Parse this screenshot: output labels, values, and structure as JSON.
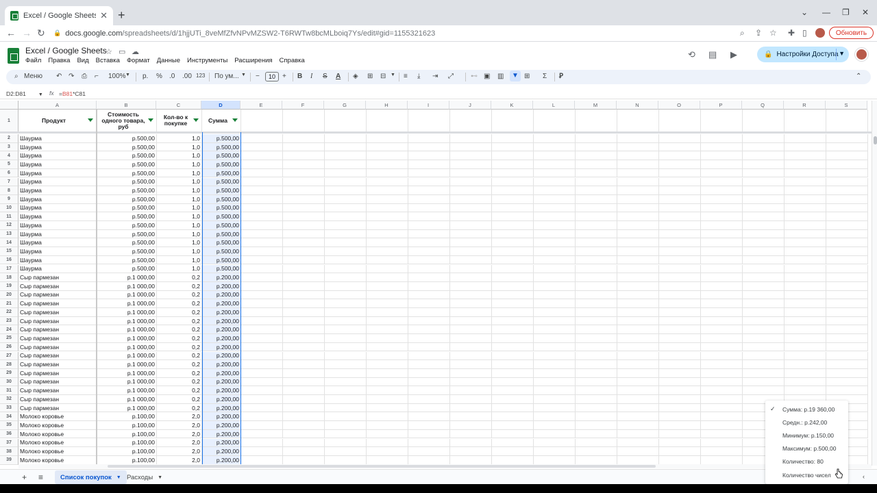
{
  "browser": {
    "tab_title": "Excel / Google Sheets - Google T",
    "url_host": "docs.google.com",
    "url_path": "/spreadsheets/d/1hjjUTi_8veMfZfvNPvMZSW2-T6RWTw8bcMLboiq7Ys/edit#gid=1155321623",
    "update_label": "Обновить"
  },
  "doc": {
    "title": "Excel / Google Sheets",
    "menus": [
      "Файл",
      "Правка",
      "Вид",
      "Вставка",
      "Формат",
      "Данные",
      "Инструменты",
      "Расширения",
      "Справка"
    ],
    "share_label": "Настройки Доступа"
  },
  "toolbar": {
    "search_label": "Меню",
    "zoom": "100%",
    "currency": "р.",
    "percent": "%",
    "dec_less": ".0",
    "dec_more": ".00",
    "num_format": "123",
    "font": "По ум...",
    "font_size": "10"
  },
  "formula_bar": {
    "name_box": "D2:D81",
    "formula_prefix": "=",
    "formula_ref1": "B81",
    "formula_rest": "*C81"
  },
  "grid": {
    "columns": [
      "A",
      "B",
      "C",
      "D",
      "E",
      "F",
      "G",
      "H",
      "I",
      "J",
      "K",
      "L",
      "M",
      "N",
      "O",
      "P",
      "Q",
      "R",
      "S"
    ],
    "headers": {
      "a": "Продукт",
      "b": [
        "Стоимость",
        "одного товара,",
        "руб"
      ],
      "c": [
        "Кол-во к",
        "покупке"
      ],
      "d": "Сумма"
    },
    "rows": [
      {
        "n": "2",
        "a": "Шаурма",
        "b": "р.500,00",
        "c": "1,0",
        "d": "р.500,00"
      },
      {
        "n": "3",
        "a": "Шаурма",
        "b": "р.500,00",
        "c": "1,0",
        "d": "р.500,00"
      },
      {
        "n": "4",
        "a": "Шаурма",
        "b": "р.500,00",
        "c": "1,0",
        "d": "р.500,00"
      },
      {
        "n": "5",
        "a": "Шаурма",
        "b": "р.500,00",
        "c": "1,0",
        "d": "р.500,00"
      },
      {
        "n": "6",
        "a": "Шаурма",
        "b": "р.500,00",
        "c": "1,0",
        "d": "р.500,00"
      },
      {
        "n": "7",
        "a": "Шаурма",
        "b": "р.500,00",
        "c": "1,0",
        "d": "р.500,00"
      },
      {
        "n": "8",
        "a": "Шаурма",
        "b": "р.500,00",
        "c": "1,0",
        "d": "р.500,00"
      },
      {
        "n": "9",
        "a": "Шаурма",
        "b": "р.500,00",
        "c": "1,0",
        "d": "р.500,00"
      },
      {
        "n": "10",
        "a": "Шаурма",
        "b": "р.500,00",
        "c": "1,0",
        "d": "р.500,00"
      },
      {
        "n": "11",
        "a": "Шаурма",
        "b": "р.500,00",
        "c": "1,0",
        "d": "р.500,00"
      },
      {
        "n": "12",
        "a": "Шаурма",
        "b": "р.500,00",
        "c": "1,0",
        "d": "р.500,00"
      },
      {
        "n": "13",
        "a": "Шаурма",
        "b": "р.500,00",
        "c": "1,0",
        "d": "р.500,00"
      },
      {
        "n": "14",
        "a": "Шаурма",
        "b": "р.500,00",
        "c": "1,0",
        "d": "р.500,00"
      },
      {
        "n": "15",
        "a": "Шаурма",
        "b": "р.500,00",
        "c": "1,0",
        "d": "р.500,00"
      },
      {
        "n": "16",
        "a": "Шаурма",
        "b": "р.500,00",
        "c": "1,0",
        "d": "р.500,00"
      },
      {
        "n": "17",
        "a": "Шаурма",
        "b": "р.500,00",
        "c": "1,0",
        "d": "р.500,00"
      },
      {
        "n": "18",
        "a": "Сыр пармезан",
        "b": "р.1 000,00",
        "c": "0,2",
        "d": "р.200,00"
      },
      {
        "n": "19",
        "a": "Сыр пармезан",
        "b": "р.1 000,00",
        "c": "0,2",
        "d": "р.200,00"
      },
      {
        "n": "20",
        "a": "Сыр пармезан",
        "b": "р.1 000,00",
        "c": "0,2",
        "d": "р.200,00"
      },
      {
        "n": "21",
        "a": "Сыр пармезан",
        "b": "р.1 000,00",
        "c": "0,2",
        "d": "р.200,00"
      },
      {
        "n": "22",
        "a": "Сыр пармезан",
        "b": "р.1 000,00",
        "c": "0,2",
        "d": "р.200,00"
      },
      {
        "n": "23",
        "a": "Сыр пармезан",
        "b": "р.1 000,00",
        "c": "0,2",
        "d": "р.200,00"
      },
      {
        "n": "24",
        "a": "Сыр пармезан",
        "b": "р.1 000,00",
        "c": "0,2",
        "d": "р.200,00"
      },
      {
        "n": "25",
        "a": "Сыр пармезан",
        "b": "р.1 000,00",
        "c": "0,2",
        "d": "р.200,00"
      },
      {
        "n": "26",
        "a": "Сыр пармезан",
        "b": "р.1 000,00",
        "c": "0,2",
        "d": "р.200,00"
      },
      {
        "n": "27",
        "a": "Сыр пармезан",
        "b": "р.1 000,00",
        "c": "0,2",
        "d": "р.200,00"
      },
      {
        "n": "28",
        "a": "Сыр пармезан",
        "b": "р.1 000,00",
        "c": "0,2",
        "d": "р.200,00"
      },
      {
        "n": "29",
        "a": "Сыр пармезан",
        "b": "р.1 000,00",
        "c": "0,2",
        "d": "р.200,00"
      },
      {
        "n": "30",
        "a": "Сыр пармезан",
        "b": "р.1 000,00",
        "c": "0,2",
        "d": "р.200,00"
      },
      {
        "n": "31",
        "a": "Сыр пармезан",
        "b": "р.1 000,00",
        "c": "0,2",
        "d": "р.200,00"
      },
      {
        "n": "32",
        "a": "Сыр пармезан",
        "b": "р.1 000,00",
        "c": "0,2",
        "d": "р.200,00"
      },
      {
        "n": "33",
        "a": "Сыр пармезан",
        "b": "р.1 000,00",
        "c": "0,2",
        "d": "р.200,00"
      },
      {
        "n": "34",
        "a": "Молоко коровье",
        "b": "р.100,00",
        "c": "2,0",
        "d": "р.200,00"
      },
      {
        "n": "35",
        "a": "Молоко коровье",
        "b": "р.100,00",
        "c": "2,0",
        "d": "р.200,00"
      },
      {
        "n": "36",
        "a": "Молоко коровье",
        "b": "р.100,00",
        "c": "2,0",
        "d": "р.200,00"
      },
      {
        "n": "37",
        "a": "Молоко коровье",
        "b": "р.100,00",
        "c": "2,0",
        "d": "р.200,00"
      },
      {
        "n": "38",
        "a": "Молоко коровье",
        "b": "р.100,00",
        "c": "2,0",
        "d": "р.200,00"
      },
      {
        "n": "39",
        "a": "Молоко коровье",
        "b": "р.100,00",
        "c": "2,0",
        "d": "р.200,00"
      }
    ]
  },
  "sheets": {
    "tabs": [
      "Список покупок",
      "Расходы"
    ]
  },
  "stats_menu": {
    "items": [
      {
        "label": "Сумма: р.19 360,00",
        "checked": true
      },
      {
        "label": "Средн.: р.242,00",
        "checked": false
      },
      {
        "label": "Минимум: р.150,00",
        "checked": false
      },
      {
        "label": "Максимум: р.500,00",
        "checked": false
      },
      {
        "label": "Количество: 80",
        "checked": false
      },
      {
        "label": "Количество чисел",
        "checked": false
      }
    ]
  },
  "colors": {
    "accent": "#1a73e8",
    "sheets_green": "#188038",
    "share_bg": "#c2e7ff",
    "update_red": "#d93025"
  }
}
